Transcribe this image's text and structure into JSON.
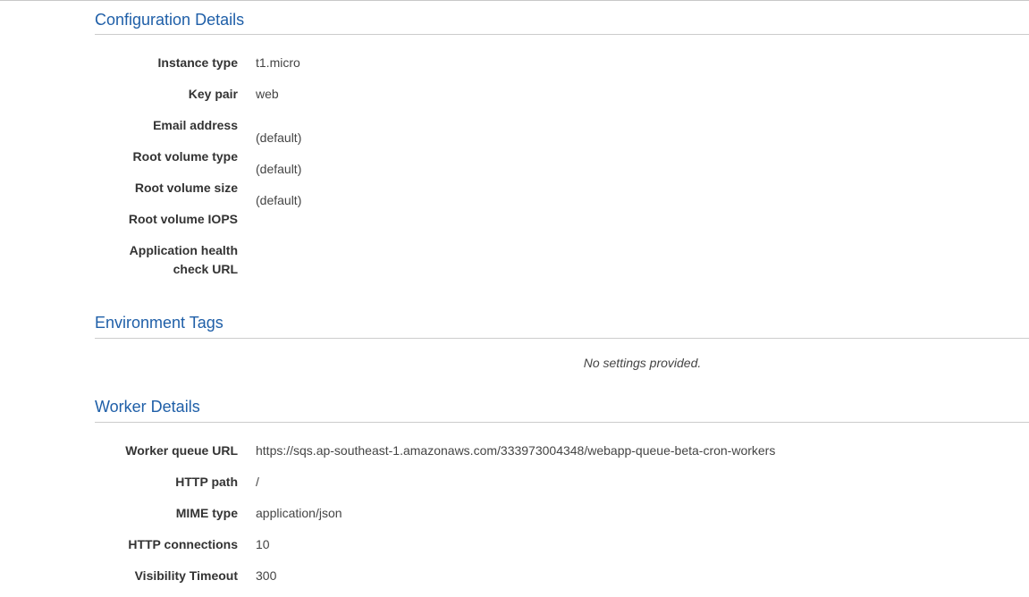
{
  "configuration": {
    "title": "Configuration Details",
    "rows": [
      {
        "label": "Instance type",
        "value": "t1.micro"
      },
      {
        "label": "Key pair",
        "value": "web"
      },
      {
        "label": "Email address",
        "value": "(default)"
      },
      {
        "label": "Root volume type",
        "value": "(default)"
      },
      {
        "label": "Root volume size",
        "value": "(default)"
      },
      {
        "label": "Root volume IOPS",
        "value": ""
      },
      {
        "label_line1": "Application health",
        "label_line2": "check URL",
        "value": ""
      }
    ]
  },
  "tags": {
    "title": "Environment Tags",
    "empty_message": "No settings provided."
  },
  "worker": {
    "title": "Worker Details",
    "rows": [
      {
        "label": "Worker queue URL",
        "value": "https://sqs.ap-southeast-1.amazonaws.com/333973004348/webapp-queue-beta-cron-workers"
      },
      {
        "label": "HTTP path",
        "value": "/"
      },
      {
        "label": "MIME type",
        "value": "application/json"
      },
      {
        "label": "HTTP connections",
        "value": "10"
      },
      {
        "label": "Visibility Timeout",
        "value": "300"
      }
    ]
  }
}
